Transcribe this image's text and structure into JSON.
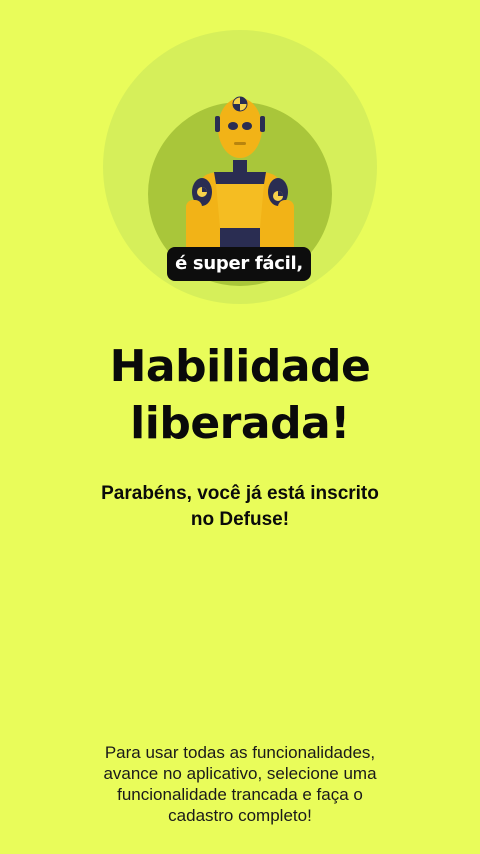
{
  "hero": {
    "illustration_icon": "crash-test-dummy-icon",
    "caption": "é super fácil,"
  },
  "title": {
    "line1": "Habilidade",
    "line2": "liberada!"
  },
  "subtitle": {
    "line1": "Parabéns, você já está inscrito",
    "line2": "no Defuse!"
  },
  "footer": {
    "line1": "Para usar todas as funcionalidades,",
    "line2": "avance no aplicativo, selecione uma",
    "line3": "funcionalidade trancada e faça o",
    "line4": "cadastro completo!"
  },
  "colors": {
    "background": "#e9fc5a",
    "circle_outer": "#d6ef5a",
    "circle_inner": "#a9c63a",
    "dummy_yellow": "#f2b317",
    "dummy_navy": "#2a2d52",
    "caption_bg": "#0d0d0d"
  }
}
